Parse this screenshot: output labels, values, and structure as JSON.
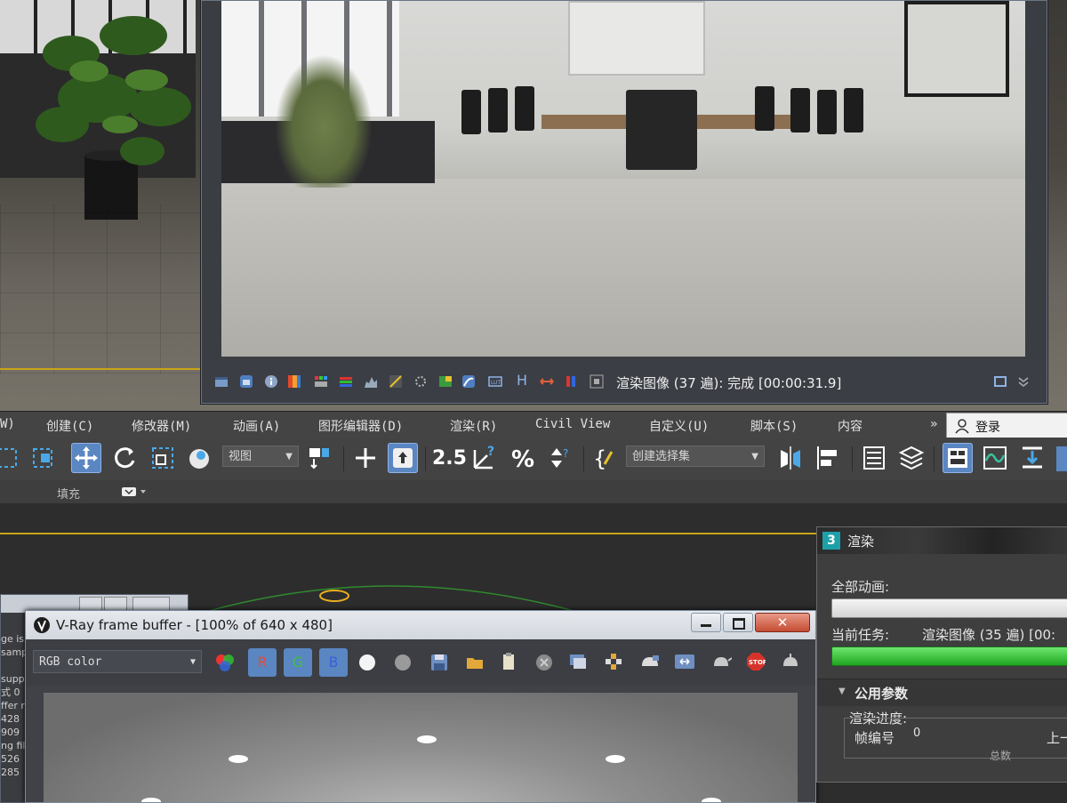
{
  "render_frame": {
    "status_label": "渲染图像",
    "status_detail": "(37 遍): 完成 [00:00:31.9]",
    "status_letter": "H"
  },
  "menubar": {
    "items": [
      "W)",
      "创建(C)",
      "修改器(M)",
      "动画(A)",
      "图形编辑器(D)",
      "渲染(R)",
      "Civil View",
      "自定义(U)",
      "脚本(S)",
      "内容"
    ],
    "overflow": "»",
    "login_label": "登录"
  },
  "toolbar": {
    "view_dropdown": "视图",
    "selection_set_dropdown": "创建选择集",
    "snap_label": "2.5"
  },
  "ribbon": {
    "fill_label": "填充"
  },
  "vfb": {
    "title": "V-Ray frame buffer - [100% of 640 x 480]",
    "channel_dropdown": "RGB color",
    "r_label": "R",
    "g_label": "G",
    "b_label": "B"
  },
  "back_window": {
    "log_lines": [
      "ge is",
      "samp",
      "",
      "supp",
      "式 0",
      "ffer r",
      "428",
      "909",
      "ng fil",
      "526",
      "285"
    ]
  },
  "render_dialog": {
    "title": "渲染",
    "all_anim_label": "全部动画:",
    "current_task_label": "当前任务:",
    "current_task_value": "渲染图像 (35 遍) [00:",
    "section_label": "公用参数",
    "progress_group": "渲染进度:",
    "frame_no_label": "帧编号",
    "frame_no_value": "0",
    "prev_label": "上一",
    "total_label": "总数"
  },
  "colors": {
    "accent_blue": "#5a86c2",
    "progress_green": "#2fb52f",
    "viewport_border_yellow": "#c8a418"
  }
}
